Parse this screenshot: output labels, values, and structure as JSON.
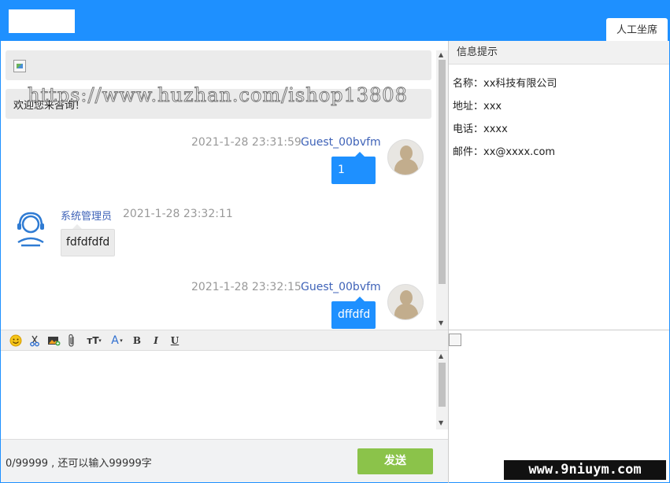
{
  "header": {
    "tab_label": "人工坐席"
  },
  "chat": {
    "welcome_text": "欢迎您来咨询！",
    "messages": [
      {
        "side": "right",
        "time": "2021-1-28 23:31:59",
        "user": "Guest_00bvfm",
        "text": "1"
      },
      {
        "side": "left",
        "time": "2021-1-28 23:32:11",
        "user": "系统管理员",
        "text": "fdfdfdfd"
      },
      {
        "side": "right",
        "time": "2021-1-28 23:32:15",
        "user": "Guest_00bvfm",
        "text": "dffdfd"
      }
    ]
  },
  "toolbar": {
    "emoji_icon": "smiley-icon",
    "scissors_icon": "scissors-icon",
    "image_icon": "image-icon",
    "attach_icon": "paperclip-icon",
    "font_size_label": "тT",
    "font_color_label": "A",
    "bold_label": "B",
    "italic_label": "I",
    "underline_label": "U"
  },
  "footer": {
    "counter_text": "0/99999 , 还可以输入99999字",
    "send_label": "发送"
  },
  "info": {
    "title": "信息提示",
    "rows": [
      "名称：xx科技有限公司",
      "地址：xxx",
      "电话：xxxx",
      "邮件：xx@xxxx.com"
    ]
  },
  "watermarks": {
    "top": "https://www.huzhan.com/ishop13808",
    "bottom": "www.9niuym.com"
  },
  "colors": {
    "accent": "#1e90ff",
    "send": "#8bc34a",
    "username": "#3f63b8"
  }
}
